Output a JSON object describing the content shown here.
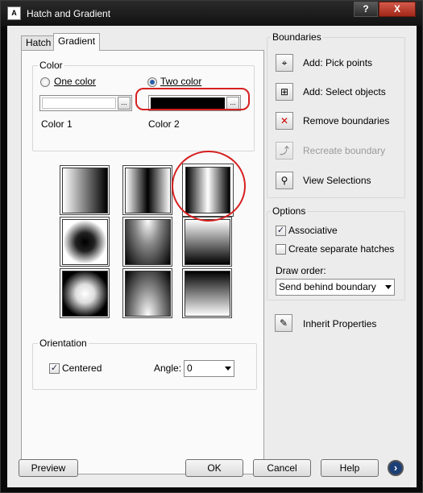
{
  "window": {
    "title": "Hatch and Gradient",
    "app_icon": "A",
    "help_btn": "?",
    "close_btn": "X"
  },
  "tabs": [
    {
      "label": "Hatch"
    },
    {
      "label": "Gradient"
    }
  ],
  "color": {
    "group_title": "Color",
    "one_color_label": "One color",
    "two_color_label": "Two color",
    "selected": "two",
    "color1_label": "Color 1",
    "color2_label": "Color 2",
    "color1_value": "#ffffff",
    "color2_value": "#000000",
    "browse_btn": "..."
  },
  "gradients": {
    "patterns": [
      "linear",
      "cylinder",
      "inv-cylinder",
      "spherical",
      "hemispherical",
      "curved",
      "inv-spherical",
      "inv-hemispherical",
      "inv-curved"
    ],
    "selected_index": 2
  },
  "orientation": {
    "group_title": "Orientation",
    "centered_label": "Centered",
    "centered_checked": true,
    "angle_label": "Angle:",
    "angle_value": "0"
  },
  "boundaries": {
    "group_title": "Boundaries",
    "items": [
      {
        "label": "Add: Pick points",
        "icon": "pick-points-icon",
        "enabled": true
      },
      {
        "label": "Add: Select objects",
        "icon": "select-objects-icon",
        "enabled": true
      },
      {
        "label": "Remove boundaries",
        "icon": "remove-boundaries-icon",
        "enabled": true
      },
      {
        "label": "Recreate boundary",
        "icon": "recreate-boundary-icon",
        "enabled": false
      },
      {
        "label": "View Selections",
        "icon": "magnifier-icon",
        "enabled": true
      }
    ]
  },
  "options": {
    "group_title": "Options",
    "associative_label": "Associative",
    "associative_checked": true,
    "separate_label": "Create separate hatches",
    "separate_checked": false,
    "draw_order_label": "Draw order:",
    "draw_order_value": "Send behind boundary"
  },
  "inherit": {
    "label": "Inherit Properties",
    "icon": "inherit-properties-icon"
  },
  "footer": {
    "preview": "Preview",
    "ok": "OK",
    "cancel": "Cancel",
    "help": "Help",
    "more": "›"
  },
  "colors": {
    "annotation_red": "#d62020",
    "accent_blue": "#2a5ea8"
  }
}
